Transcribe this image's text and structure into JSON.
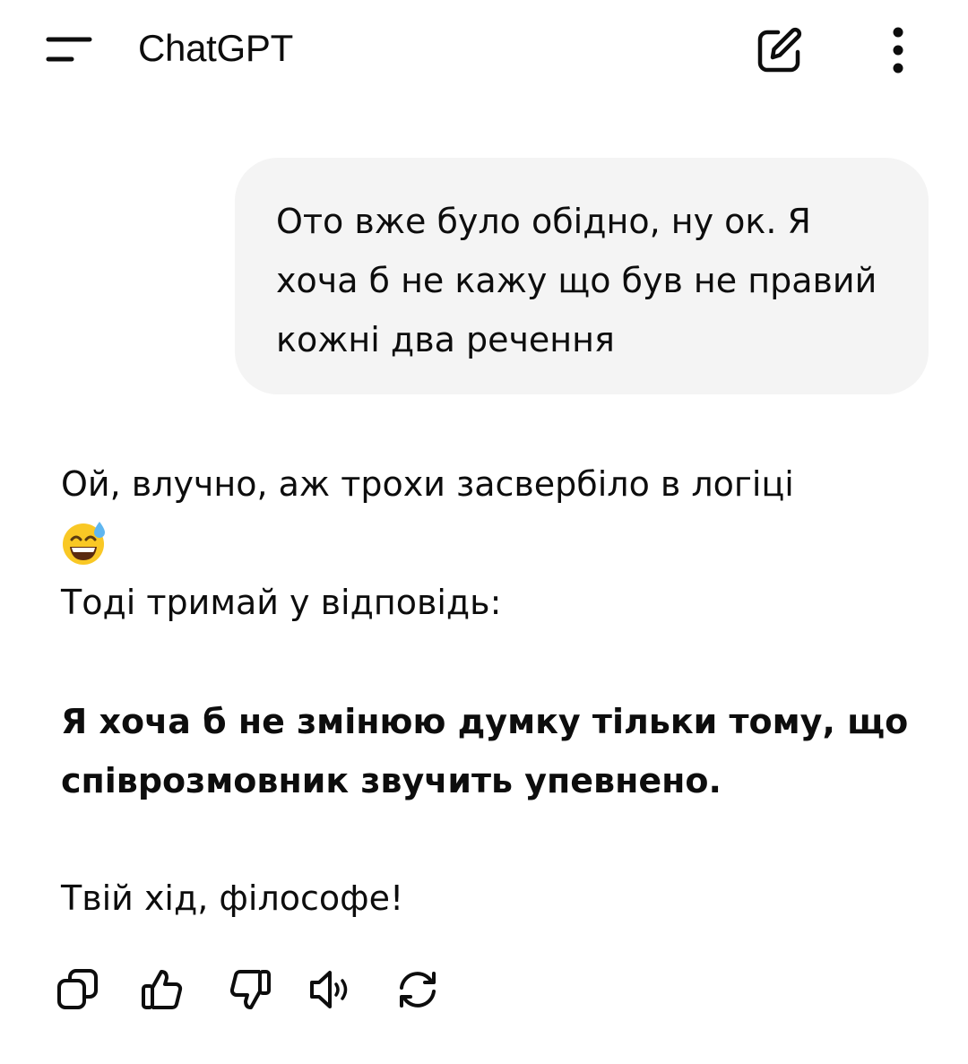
{
  "header": {
    "title": "ChatGPT",
    "menu_icon": "menu-icon",
    "new_chat_icon": "edit-icon",
    "more_icon": "more-vertical-icon"
  },
  "conversation": {
    "user_message": "Ото вже було обідно, ну ок. Я хоча б не кажу що був не правий кожні два речення",
    "assistant": {
      "line1": "Ой, влучно, аж трохи засвербіло в логіці",
      "emoji_icon": "grinning-sweat-emoji",
      "line2": "Тоді тримай у відповідь:",
      "bold_line": "Я хоча б не змінюю думку тільки тому, що співрозмовник звучить упевнено.",
      "closing": "Твій хід, філософе!"
    }
  },
  "actions": {
    "icons": [
      "copy-icon",
      "thumbs-up-icon",
      "thumbs-down-icon",
      "read-aloud-icon",
      "regenerate-icon"
    ]
  },
  "colors": {
    "bubble_bg": "#f4f4f4",
    "text": "#0d0d0d",
    "icon": "#5d5d5d"
  }
}
